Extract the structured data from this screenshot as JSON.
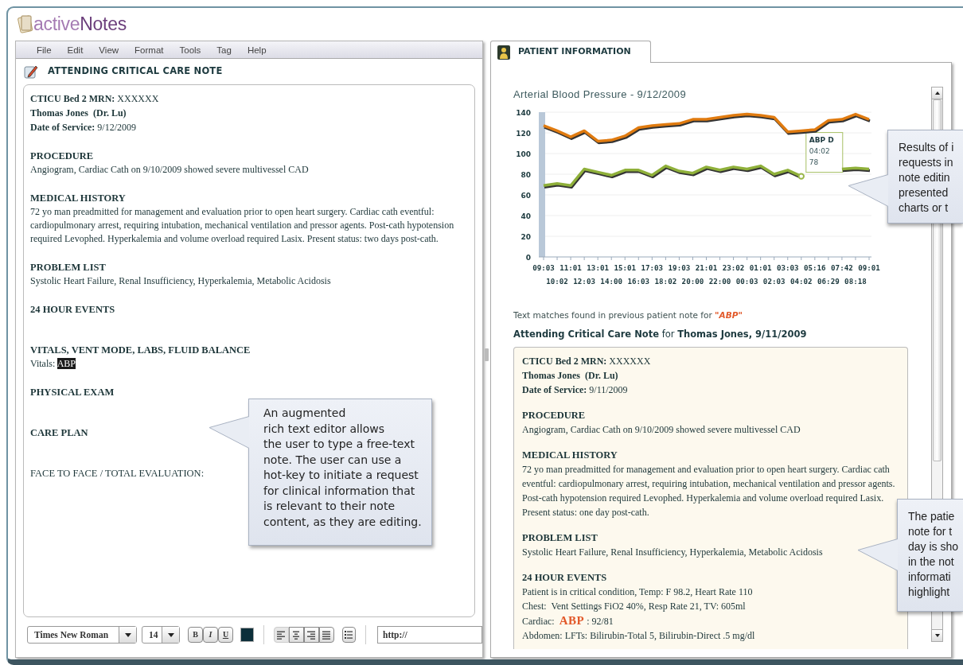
{
  "app": {
    "logo_light": "active",
    "logo_dark": "Notes"
  },
  "menu": [
    "File",
    "Edit",
    "View",
    "Format",
    "Tools",
    "Tag",
    "Help"
  ],
  "editor": {
    "title": "ATTENDING CRITICAL CARE NOTE",
    "note": {
      "header": [
        {
          "text": "**CTICU Bed 2 MRN:** XXXXXX",
          "bold": false
        },
        {
          "text": "Thomas Jones  (Dr. Lu)",
          "bold": true
        },
        {
          "text": "**Date of Service:** 9/12/2009",
          "bold": false
        }
      ],
      "sections": [
        {
          "heading": "PROCEDURE",
          "heading_bold": true,
          "lines": [
            "Angiogram, Cardiac Cath on 9/10/2009 showed severe multivessel CAD"
          ]
        },
        {
          "heading": "MEDICAL HISTORY",
          "heading_bold": true,
          "lines": [
            "72 yo man preadmitted for management and evaluation prior to open heart surgery. Cardiac cath eventful: cardiopulmonary arrest, requiring intubation, mechanical ventilation and pressor agents. Post-cath hypotension required Levophed. Hyperkalemia and volume overload required Lasix. Present status: two days post-cath."
          ]
        },
        {
          "heading": "PROBLEM LIST",
          "heading_bold": true,
          "lines": [
            "Systolic Heart Failure, Renal Insufficiency, Hyperkalemia, Metabolic Acidosis"
          ]
        },
        {
          "heading": "24 HOUR EVENTS",
          "heading_bold": true
        },
        {
          "heading": "VITALS, VENT MODE, LABS, FLUID BALANCE",
          "heading_bold": true,
          "lines": [
            {
              "parts": [
                {
                  "text": "Vitals: ",
                  "kind": "plain"
                },
                {
                  "text": "ABP",
                  "kind": "selection"
                }
              ]
            }
          ]
        },
        {
          "heading": "PHYSICAL EXAM",
          "heading_bold": true
        },
        {
          "heading": "CARE PLAN",
          "heading_bold": true
        },
        {
          "heading": "FACE TO FACE / TOTAL EVALUATION:",
          "heading_bold": false
        }
      ]
    }
  },
  "toolbar": {
    "font": "Times New Roman",
    "size": "14",
    "format_buttons": [
      {
        "label": "B",
        "kind": "bold"
      },
      {
        "label": "I",
        "kind": "italic"
      },
      {
        "label": "U",
        "kind": "underline"
      }
    ],
    "align_buttons": [
      {
        "kind": "left",
        "selected": true
      },
      {
        "kind": "center",
        "selected": false
      },
      {
        "kind": "right",
        "selected": false
      },
      {
        "kind": "justify",
        "selected": false
      }
    ],
    "link_field": {
      "value": "http://"
    }
  },
  "patient_panel": {
    "tab": {
      "label": "PATIENT INFORMATION",
      "selected": true
    },
    "chart_data": {
      "type": "line",
      "title": "Arterial Blood Pressure - 9/12/2009",
      "categories": [
        "09:03",
        "10:02",
        "11:01",
        "12:03",
        "13:01",
        "14:00",
        "15:01",
        "16:03",
        "17:03",
        "18:02",
        "19:03",
        "20:00",
        "21:01",
        "22:00",
        "23:02",
        "00:03",
        "01:01",
        "02:03",
        "03:03",
        "04:02",
        "05:16",
        "06:29",
        "07:42",
        "08:18",
        "09:01"
      ],
      "series": [
        {
          "color": "#e07b10",
          "values": [
            127,
            122,
            116,
            122,
            112,
            113,
            117,
            125,
            127,
            128,
            129,
            133,
            133,
            135,
            137,
            138,
            137,
            135,
            121,
            122,
            123,
            132,
            133,
            138,
            133
          ]
        },
        {
          "color": "#8fb03a",
          "values": [
            69,
            71,
            69,
            85,
            82,
            79,
            84,
            84,
            79,
            88,
            83,
            81,
            87,
            84,
            87,
            85,
            88,
            80,
            84,
            78,
            null,
            null,
            85,
            86,
            85
          ]
        }
      ],
      "ylim": [
        0,
        140
      ],
      "yticks": [
        0,
        20,
        40,
        60,
        80,
        100,
        120,
        140
      ],
      "grid": true
    },
    "tooltip": {
      "series": "ABP D",
      "time": "04:02",
      "value": "78"
    },
    "match_sentence": {
      "text": "Text matches found in previous patient note for ",
      "term": "\"ABP\""
    },
    "previous_note_title": "**Attending Critical Care Note** for **Thomas Jones, 9/11/2009**",
    "previous_note": {
      "header": [
        {
          "text": "**CTICU Bed 2 MRN:** XXXXXX",
          "bold": false
        },
        {
          "text": "Thomas Jones  (Dr. Lu)",
          "bold": true
        },
        {
          "text": "**Date of Service:** 9/11/2009",
          "bold": false
        }
      ],
      "sections": [
        {
          "heading": "PROCEDURE",
          "heading_bold": true,
          "lines": [
            "Angiogram, Cardiac Cath on 9/10/2009 showed severe multivessel CAD"
          ]
        },
        {
          "heading": "MEDICAL HISTORY",
          "heading_bold": true,
          "lines": [
            "72 yo man preadmitted for management and evaluation prior to open heart surgery. Cardiac cath eventful: cardiopulmonary arrest, requiring intubation, mechanical ventilation and pressor agents. Post-cath hypotension required Levophed. Hyperkalemia and volume overload required Lasix. Present status: one day post-cath."
          ]
        },
        {
          "heading": "PROBLEM LIST",
          "heading_bold": true,
          "lines": [
            "Systolic Heart Failure, Renal Insufficiency, Hyperkalemia, Metabolic Acidosis"
          ]
        },
        {
          "heading": "24 HOUR EVENTS",
          "heading_bold": true,
          "lines": [
            "Patient is in critical condition, Temp: F 98.2, Heart Rate 110",
            "Chest:  Vent Settings FiO2 40%, Resp Rate 21, TV: 605ml",
            {
              "parts": [
                {
                  "text": "Cardiac:  ",
                  "kind": "plain"
                },
                {
                  "text": "ABP",
                  "kind": "match"
                },
                {
                  "text": " : 92/81",
                  "kind": "plain"
                }
              ]
            },
            "Abdomen: LFTs: Bilirubin-Total 5, Bilirubin-Direct .5 mg/dl"
          ]
        }
      ]
    }
  },
  "callouts": [
    {
      "kind": "editor",
      "lines": [
        "An augmented",
        "rich text editor allows",
        "the user to type a free-text",
        "note. The user can use a",
        "hot-key to initiate a request",
        "for clinical information that",
        "is relevant to their note",
        "content, as they are editing."
      ]
    },
    {
      "kind": "chart",
      "lines": [
        "Results of i",
        "requests in",
        "note editin",
        "presented",
        "charts or t"
      ]
    },
    {
      "kind": "note",
      "lines": [
        "The patie",
        "note for t",
        "day is sho",
        "in the not",
        "informati",
        "highlight"
      ]
    }
  ]
}
